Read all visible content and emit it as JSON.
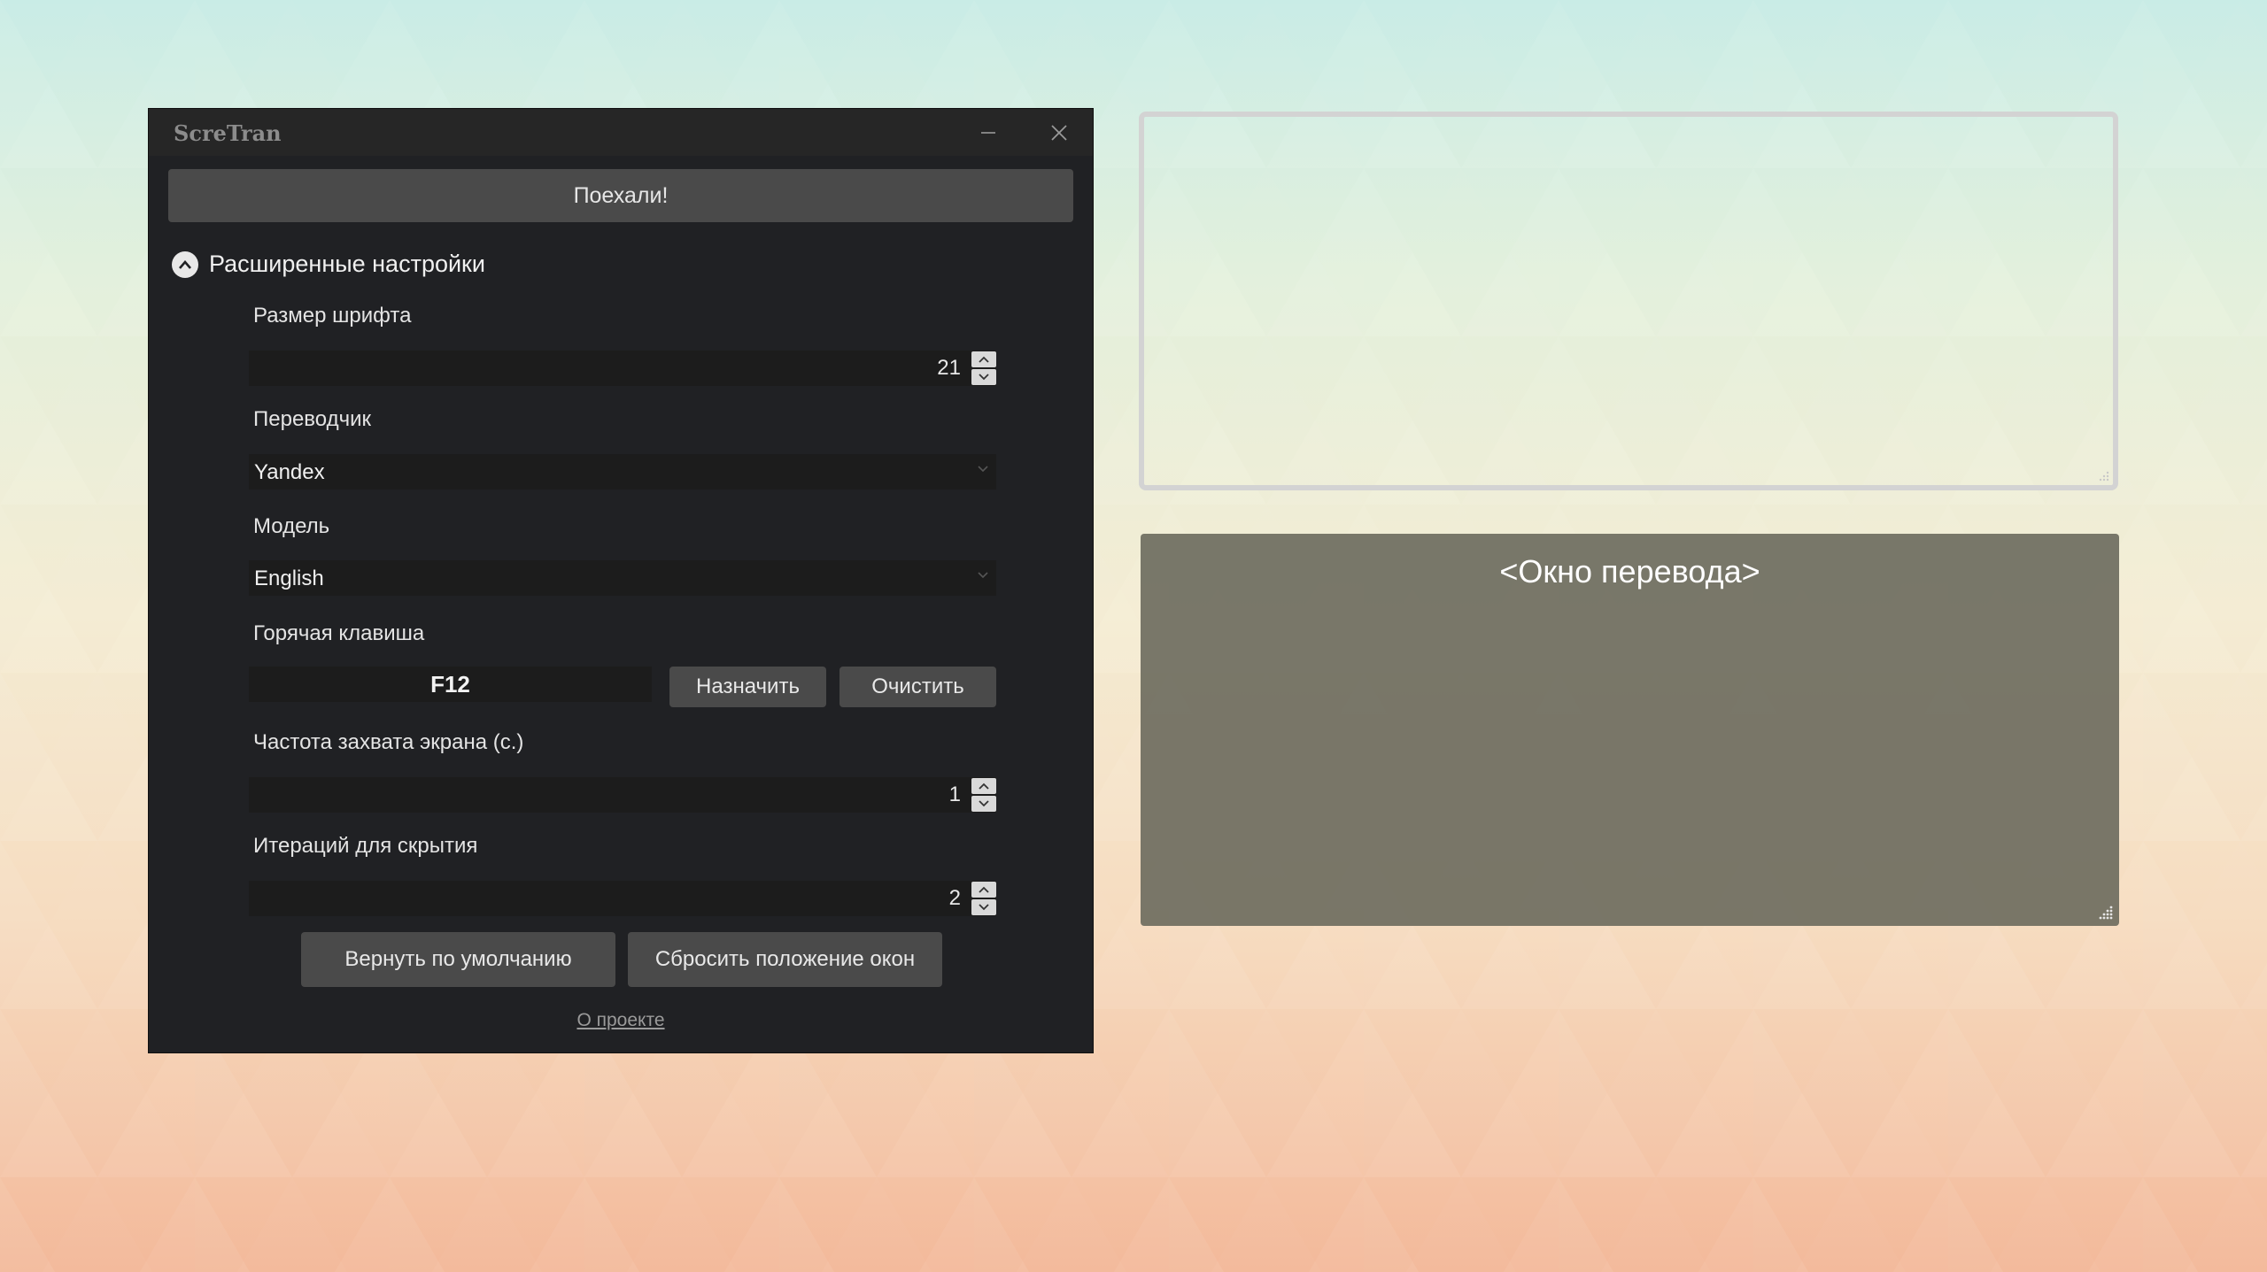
{
  "window": {
    "title": "ScreTran",
    "minimize_icon": "minimize-icon",
    "close_icon": "close-icon"
  },
  "go_button": "Поехали!",
  "advanced": {
    "label": "Расширенные настройки",
    "icon": "chevron-up-icon",
    "expanded": true
  },
  "font_size": {
    "label": "Размер шрифта",
    "value": "21"
  },
  "translator": {
    "label": "Переводчик",
    "value": "Yandex"
  },
  "model": {
    "label": "Модель",
    "value": "English"
  },
  "hotkey": {
    "label": "Горячая клавиша",
    "value": "F12",
    "assign_label": "Назначить",
    "clear_label": "Очистить"
  },
  "capture_rate": {
    "label": "Частота захвата экрана (с.)",
    "value": "1"
  },
  "hide_iterations": {
    "label": "Итераций для скрытия",
    "value": "2"
  },
  "actions": {
    "reset_defaults": "Вернуть по умолчанию",
    "reset_positions": "Сбросить положение окон"
  },
  "about_link": "О проекте",
  "translation_window": {
    "label": "<Окно перевода>"
  },
  "colors": {
    "window_bg": "#202124",
    "button_bg": "#4a4a4a",
    "field_bg": "#1c1c1c",
    "translation_bg": "#6e6c5f"
  }
}
